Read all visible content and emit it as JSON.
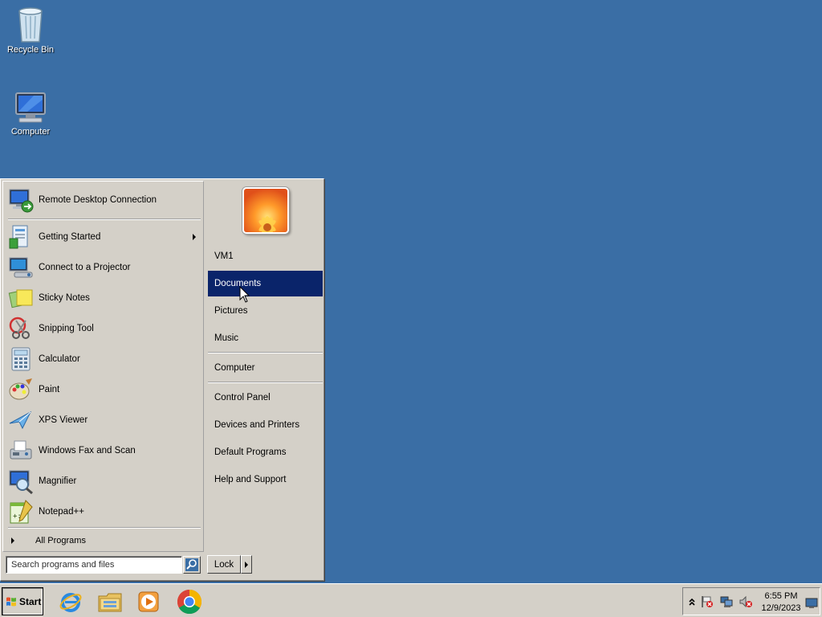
{
  "desktop": {
    "icons": [
      {
        "label": "Recycle Bin",
        "icon": "recycle-bin-icon"
      },
      {
        "label": "Computer",
        "icon": "computer-icon"
      }
    ]
  },
  "start_menu": {
    "pinned": {
      "label": "Remote Desktop Connection",
      "icon": "remote-desktop-icon"
    },
    "recent": [
      {
        "label": "Getting Started",
        "icon": "getting-started-icon",
        "submenu": true
      },
      {
        "label": "Connect to a Projector",
        "icon": "projector-icon"
      },
      {
        "label": "Sticky Notes",
        "icon": "sticky-notes-icon"
      },
      {
        "label": "Snipping Tool",
        "icon": "snipping-tool-icon"
      },
      {
        "label": "Calculator",
        "icon": "calculator-icon"
      },
      {
        "label": "Paint",
        "icon": "paint-icon"
      },
      {
        "label": "XPS Viewer",
        "icon": "xps-viewer-icon"
      },
      {
        "label": "Windows Fax and Scan",
        "icon": "fax-scan-icon"
      },
      {
        "label": "Magnifier",
        "icon": "magnifier-icon"
      },
      {
        "label": "Notepad++",
        "icon": "notepad-plus-plus-icon"
      }
    ],
    "all_programs": "All Programs",
    "places": [
      {
        "label": "VM1"
      },
      {
        "label": "Documents",
        "highlighted": true
      },
      {
        "label": "Pictures"
      },
      {
        "label": "Music"
      },
      {
        "label": "Computer"
      },
      {
        "label": "Control Panel"
      },
      {
        "label": "Devices and Printers"
      },
      {
        "label": "Default Programs"
      },
      {
        "label": "Help and Support"
      }
    ],
    "search_placeholder": "Search programs and files",
    "lock_label": "Lock"
  },
  "taskbar": {
    "start_label": "Start",
    "pinned": [
      "internet-explorer-icon",
      "windows-explorer-icon",
      "media-player-icon",
      "chrome-icon"
    ],
    "tray_icons": [
      "show-hidden-icons-icon",
      "action-center-flag-icon",
      "network-icon",
      "volume-muted-icon"
    ],
    "time": "6:55 PM",
    "date": "12/9/2023"
  },
  "colors": {
    "desktop": "#3a6ea5",
    "highlight": "#0a246a",
    "face": "#d4d0c8"
  }
}
